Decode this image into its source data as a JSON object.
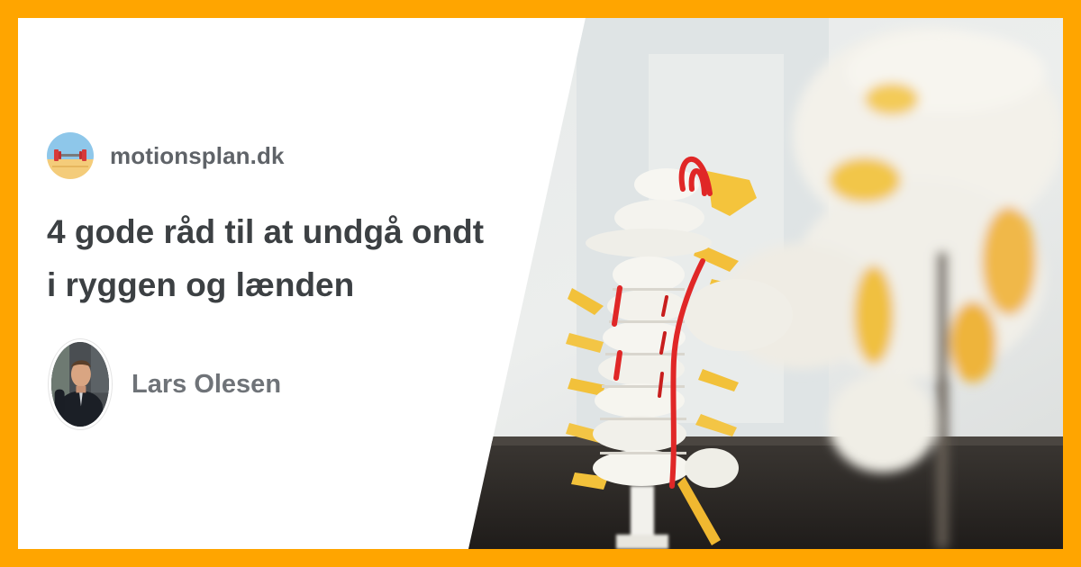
{
  "site": {
    "name": "motionsplan.dk",
    "logo_icon": "dumbbell-logo-icon"
  },
  "article": {
    "headline_line1": "4 gode råd til at undgå ondt",
    "headline_line2": "i ryggen og lænden"
  },
  "author": {
    "name": "Lars Olesen",
    "avatar_icon": "author-photo"
  },
  "colors": {
    "frame": "#FFA500",
    "card": "#FFFFFF",
    "headline": "#3C4043",
    "muted": "#5F6368"
  },
  "hero_image": {
    "subject": "spine-model-photo"
  }
}
